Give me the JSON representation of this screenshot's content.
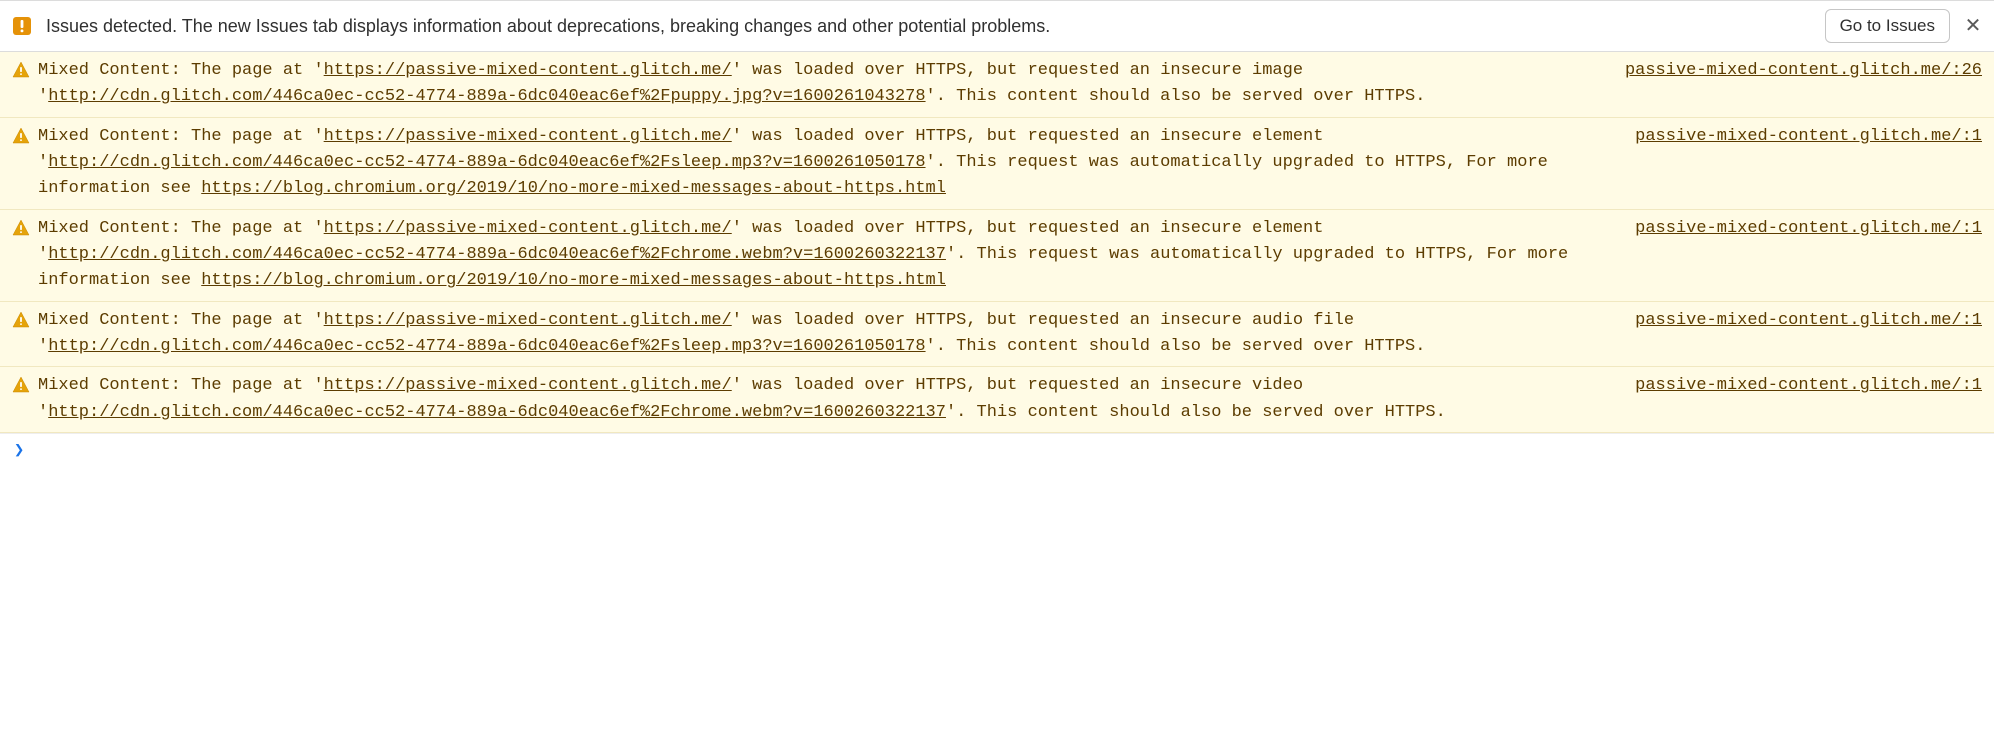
{
  "issues_bar": {
    "text": "Issues detected. The new Issues tab displays information about deprecations, breaking changes and other potential problems.",
    "button": "Go to Issues",
    "close": "✕"
  },
  "messages": [
    {
      "p1": "Mixed Content: The page at '",
      "u1": "https://passive-mixed-content.glitch.me/",
      "p2": "' was loaded over HTTPS, but requested an insecure image '",
      "u2": "http://cdn.glitch.com/446ca0ec-cc52-4774-889a-6dc040eac6ef%2Fpuppy.jpg?v=1600261043278",
      "p3": "'. This content should also be served over HTTPS.",
      "u3": "",
      "p4": "",
      "src": "passive-mixed-content.glitch.me/:26"
    },
    {
      "p1": "Mixed Content: The page at '",
      "u1": "https://passive-mixed-content.glitch.me/",
      "p2": "' was loaded over HTTPS, but requested an insecure element '",
      "u2": "http://cdn.glitch.com/446ca0ec-cc52-4774-889a-6dc040eac6ef%2Fsleep.mp3?v=1600261050178",
      "p3": "'. This request was automatically upgraded to HTTPS, For more information see ",
      "u3": "https://blog.chromium.org/2019/10/no-more-mixed-messages-about-https.html",
      "p4": "",
      "src": "passive-mixed-content.glitch.me/:1"
    },
    {
      "p1": "Mixed Content: The page at '",
      "u1": "https://passive-mixed-content.glitch.me/",
      "p2": "' was loaded over HTTPS, but requested an insecure element '",
      "u2": "http://cdn.glitch.com/446ca0ec-cc52-4774-889a-6dc040eac6ef%2Fchrome.webm?v=1600260322137",
      "p3": "'. This request was automatically upgraded to HTTPS, For more information see ",
      "u3": "https://blog.chromium.org/2019/10/no-more-mixed-messages-about-https.html",
      "p4": "",
      "src": "passive-mixed-content.glitch.me/:1"
    },
    {
      "p1": "Mixed Content: The page at '",
      "u1": "https://passive-mixed-content.glitch.me/",
      "p2": "' was loaded over HTTPS, but requested an insecure audio file '",
      "u2": "http://cdn.glitch.com/446ca0ec-cc52-4774-889a-6dc040eac6ef%2Fsleep.mp3?v=1600261050178",
      "p3": "'. This content should also be served over HTTPS.",
      "u3": "",
      "p4": "",
      "src": "passive-mixed-content.glitch.me/:1"
    },
    {
      "p1": "Mixed Content: The page at '",
      "u1": "https://passive-mixed-content.glitch.me/",
      "p2": "' was loaded over HTTPS, but requested an insecure video '",
      "u2": "http://cdn.glitch.com/446ca0ec-cc52-4774-889a-6dc040eac6ef%2Fchrome.webm?v=1600260322137",
      "p3": "'. This content should also be served over HTTPS.",
      "u3": "",
      "p4": "",
      "src": "passive-mixed-content.glitch.me/:1"
    }
  ],
  "prompt": "❯"
}
